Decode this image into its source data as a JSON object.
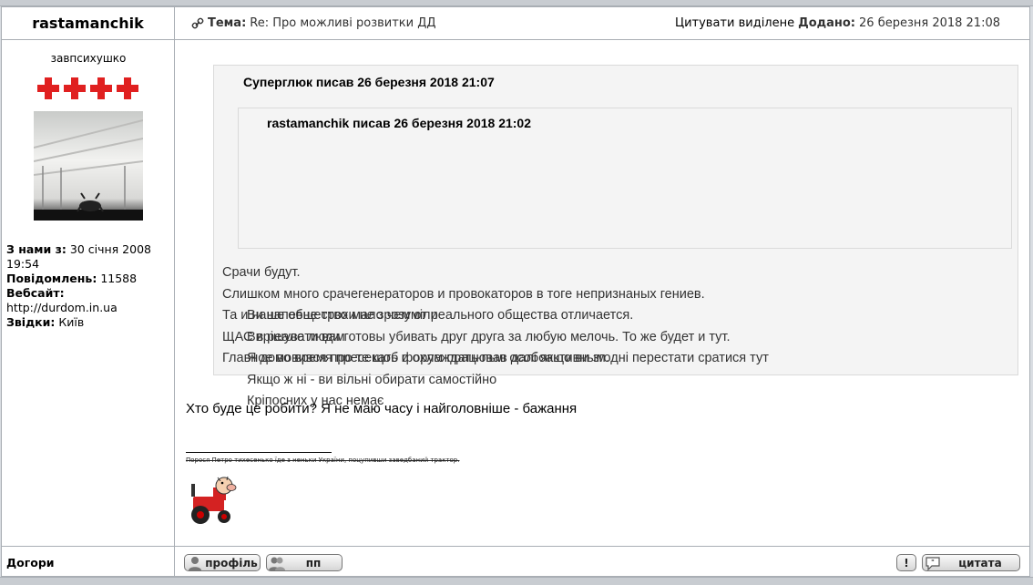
{
  "post": {
    "author": "rastamanchik",
    "topic_label": "Тема:",
    "topic_value": "Re: Про можливі розвитки ДД",
    "quote_selected": "Цитувати виділене",
    "added_label": "Додано:",
    "added_value": "26 березня 2018 21:08"
  },
  "profile": {
    "rank": "завпсихушко",
    "joined_label": "З нами з:",
    "joined_value": "30 січня 2008 19:54",
    "posts_label": "Повідомлень:",
    "posts_value": "11588",
    "website_label": "Вебсайт:",
    "website_value": "http://durdom.in.ua",
    "from_label": "Звідки:",
    "from_value": "Київ"
  },
  "quote_outer": {
    "header": "Суперглюк писав 26 березня 2018 21:07",
    "lines": [
      "Срачи будут.",
      "Слишком много срачегенераторов и провокаторов в тоге непризнаных гениев.",
      "Та и наше общество мало чем от реального общества отличается.",
      "ЩАС в реале люди готовы убивать друг друга за любую мелочь. То же будет и тут.",
      "Главное во время пресекать и охлаждать пыл особоактивным."
    ]
  },
  "quote_inner": {
    "header": "rastamanchik писав 26 березня 2018 21:02",
    "lines": [
      "Ви напевне трохи не зрозуміли",
      "Вирішувати вам",
      "Я домовився про те щоб форум працював далі якщо ви згодні перестати сратися тут",
      "Якщо ж ні - ви вільні обирати самостійно",
      "Кріпосних у нас немає"
    ]
  },
  "reply": "Хто буде це робити? Я не маю часу і найголовніше - бажання",
  "signature": "Порося Петро тихесенько їде з неньки України, поцупивши заведбаний трактор.",
  "footer": {
    "back_to_top": "Догори",
    "profile_btn": "профіль",
    "pm_btn": "пп",
    "report_btn": "!",
    "quote_btn": "цитата"
  },
  "colors": {
    "border": "#a9aeb4",
    "quote_bg": "#f4f4f4",
    "cross_red": "#e02020"
  }
}
